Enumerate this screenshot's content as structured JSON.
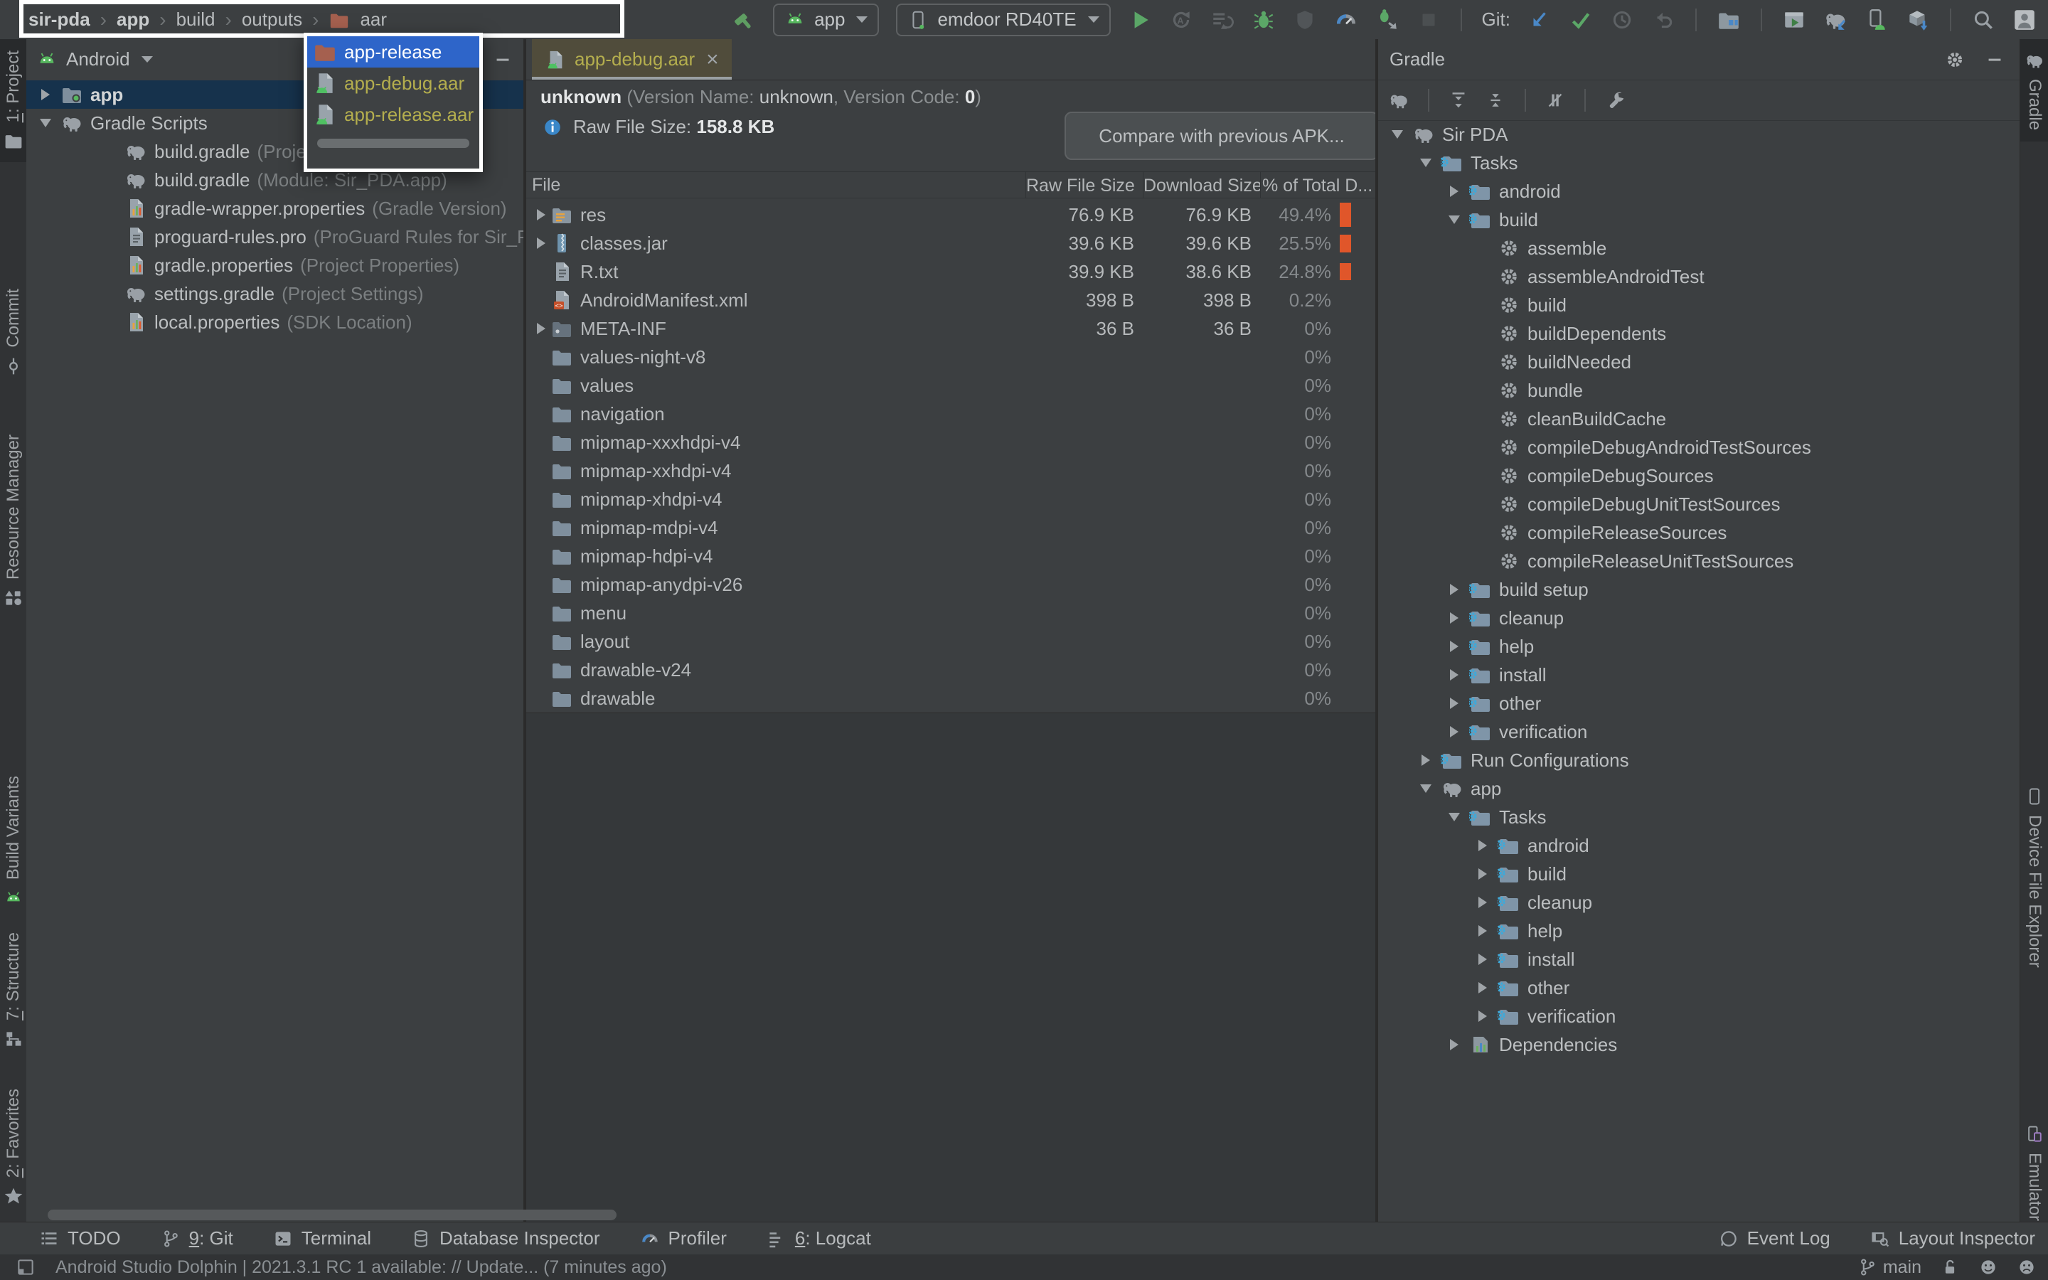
{
  "topbar": {
    "separator": "›",
    "breadcrumbs": [
      {
        "label": "sir-pda",
        "bold": true
      },
      {
        "label": "app",
        "bold": true
      },
      {
        "label": "build",
        "bold": false
      },
      {
        "label": "outputs",
        "bold": false
      },
      {
        "label": "aar",
        "bold": false,
        "icon": "folder-brown-icon"
      }
    ],
    "run_config": {
      "icon": "android-robot-icon",
      "label": "app"
    },
    "device": {
      "icon": "phone-green-dot-icon",
      "label": "emdoor RD40TE"
    },
    "git_label": "Git:",
    "groups": [
      {
        "type": "icons",
        "items": [
          {
            "icon": "hammer-icon",
            "enabled": true
          }
        ]
      },
      {
        "type": "combo",
        "ref": "run_config"
      },
      {
        "type": "combo",
        "ref": "device"
      },
      {
        "type": "icons",
        "items": [
          {
            "icon": "run-icon",
            "enabled": true
          },
          {
            "icon": "rerun-icon",
            "enabled": false
          },
          {
            "icon": "apply-changes-icon",
            "enabled": false
          },
          {
            "icon": "debug-icon",
            "enabled": true
          },
          {
            "icon": "profile-icon",
            "enabled": false
          },
          {
            "icon": "profiler-icon",
            "enabled": true
          },
          {
            "icon": "attach-debugger-icon",
            "enabled": true
          },
          {
            "icon": "stop-icon",
            "enabled": false
          }
        ]
      },
      {
        "type": "sep"
      },
      {
        "type": "label",
        "ref": "git_label"
      },
      {
        "type": "icons",
        "items": [
          {
            "icon": "git-update-icon",
            "enabled": true
          },
          {
            "icon": "git-commit-icon",
            "enabled": true
          },
          {
            "icon": "history-icon",
            "enabled": false
          },
          {
            "icon": "rollback-icon",
            "enabled": false
          }
        ]
      },
      {
        "type": "sep"
      },
      {
        "type": "icons",
        "items": [
          {
            "icon": "device-manager-icon",
            "enabled": true
          }
        ]
      },
      {
        "type": "sep"
      },
      {
        "type": "icons",
        "items": [
          {
            "icon": "run-anything-icon",
            "enabled": true
          },
          {
            "icon": "gradle-sync-icon",
            "enabled": true
          },
          {
            "icon": "pair-device-icon",
            "enabled": true
          },
          {
            "icon": "sdk-manager-icon",
            "enabled": true
          }
        ]
      },
      {
        "type": "sep"
      },
      {
        "type": "icons",
        "items": [
          {
            "icon": "search-icon",
            "enabled": true
          },
          {
            "icon": "avatar-icon",
            "enabled": true
          }
        ]
      }
    ]
  },
  "left_strip": [
    {
      "label": "1: Project",
      "icon": "project-folder-icon",
      "active": true
    },
    {
      "label": "Commit",
      "icon": "commit-icon",
      "active": false
    },
    {
      "label": "Resource Manager",
      "icon": "resource-manager-icon",
      "active": false
    },
    {
      "label": "Build Variants",
      "icon": "android-robot-icon",
      "active": false
    },
    {
      "label": "7: Structure",
      "icon": "structure-icon",
      "active": false
    },
    {
      "label": "2: Favorites",
      "icon": "star-icon",
      "active": false
    }
  ],
  "right_strip": [
    {
      "label": "Gradle",
      "icon": "elephant-icon",
      "active": true
    },
    {
      "label": "Device File Explorer",
      "icon": "device-phone-icon",
      "active": false
    },
    {
      "label": "Emulator",
      "icon": "emulator-phone-icon",
      "active": false
    }
  ],
  "project_panel": {
    "selector": {
      "icon": "android-robot-icon",
      "label": "Android"
    },
    "hide_icon": "hide-icon",
    "tree": [
      {
        "label": "app",
        "secondary": "",
        "icon": "module-folder-icon",
        "arrow": "closed",
        "indent": 0,
        "bold": true,
        "selected": true
      },
      {
        "label": "Gradle Scripts",
        "secondary": "",
        "icon": "elephant-icon",
        "arrow": "open",
        "indent": 0,
        "bold": false,
        "selected": false
      },
      {
        "label": "build.gradle",
        "secondary": "(Project: Sir_PDA)",
        "icon": "elephant-icon",
        "arrow": "none",
        "indent": 1,
        "bold": false,
        "selected": false
      },
      {
        "label": "build.gradle",
        "secondary": "(Module: Sir_PDA.app)",
        "icon": "elephant-icon",
        "arrow": "none",
        "indent": 1,
        "bold": false,
        "selected": false
      },
      {
        "label": "gradle-wrapper.properties",
        "secondary": "(Gradle Version)",
        "icon": "properties-file-icon",
        "arrow": "none",
        "indent": 1,
        "bold": false,
        "selected": false
      },
      {
        "label": "proguard-rules.pro",
        "secondary": "(ProGuard Rules for Sir_PDA)",
        "icon": "text-file-icon",
        "arrow": "none",
        "indent": 1,
        "bold": false,
        "selected": false
      },
      {
        "label": "gradle.properties",
        "secondary": "(Project Properties)",
        "icon": "properties-file-icon",
        "arrow": "none",
        "indent": 1,
        "bold": false,
        "selected": false
      },
      {
        "label": "settings.gradle",
        "secondary": "(Project Settings)",
        "icon": "elephant-icon",
        "arrow": "none",
        "indent": 1,
        "bold": false,
        "selected": false
      },
      {
        "label": "local.properties",
        "secondary": "(SDK Location)",
        "icon": "properties-file-icon",
        "arrow": "none",
        "indent": 1,
        "bold": false,
        "selected": false
      }
    ]
  },
  "popup": {
    "items": [
      {
        "label": "app-release",
        "icon": "folder-brown-icon",
        "selected": true
      },
      {
        "label": "app-debug.aar",
        "icon": "aar-file-icon",
        "selected": false
      },
      {
        "label": "app-release.aar",
        "icon": "aar-file-icon",
        "selected": false
      }
    ]
  },
  "analyzer": {
    "tab": {
      "icon": "aar-file-icon",
      "label": "app-debug.aar",
      "close": "×"
    },
    "version": {
      "name": "unknown",
      "part1": " (Version Name: ",
      "vname": "unknown",
      "part2": ", Version Code: ",
      "vcode": "0",
      "part3": ")"
    },
    "raw_icon": "info-icon",
    "raw_label": "Raw File Size: ",
    "raw_value": "158.8 KB",
    "compare_button": "Compare with previous APK...",
    "table": {
      "columns": [
        "File",
        "Raw File Size",
        "Download Size",
        "% of Total D..."
      ],
      "rows": [
        {
          "name": "res",
          "icon": "res-folder-icon",
          "expandable": true,
          "raw": "76.9 KB",
          "download": "76.9 KB",
          "pct": "49.4%",
          "bar": 0.85
        },
        {
          "name": "classes.jar",
          "icon": "jar-icon",
          "expandable": true,
          "raw": "39.6 KB",
          "download": "39.6 KB",
          "pct": "25.5%",
          "bar": 0.62
        },
        {
          "name": "R.txt",
          "icon": "text-file-icon",
          "expandable": false,
          "raw": "39.9 KB",
          "download": "38.6 KB",
          "pct": "24.8%",
          "bar": 0.6
        },
        {
          "name": "AndroidManifest.xml",
          "icon": "xml-file-icon",
          "expandable": false,
          "raw": "398 B",
          "download": "398 B",
          "pct": "0.2%",
          "bar": 0
        },
        {
          "name": "META-INF",
          "icon": "meta-folder-icon",
          "expandable": true,
          "raw": "36 B",
          "download": "36 B",
          "pct": "0%",
          "bar": 0
        },
        {
          "name": "values-night-v8",
          "icon": "folder-icon",
          "expandable": false,
          "raw": "",
          "download": "",
          "pct": "0%",
          "bar": 0
        },
        {
          "name": "values",
          "icon": "folder-icon",
          "expandable": false,
          "raw": "",
          "download": "",
          "pct": "0%",
          "bar": 0
        },
        {
          "name": "navigation",
          "icon": "folder-icon",
          "expandable": false,
          "raw": "",
          "download": "",
          "pct": "0%",
          "bar": 0
        },
        {
          "name": "mipmap-xxxhdpi-v4",
          "icon": "folder-icon",
          "expandable": false,
          "raw": "",
          "download": "",
          "pct": "0%",
          "bar": 0
        },
        {
          "name": "mipmap-xxhdpi-v4",
          "icon": "folder-icon",
          "expandable": false,
          "raw": "",
          "download": "",
          "pct": "0%",
          "bar": 0
        },
        {
          "name": "mipmap-xhdpi-v4",
          "icon": "folder-icon",
          "expandable": false,
          "raw": "",
          "download": "",
          "pct": "0%",
          "bar": 0
        },
        {
          "name": "mipmap-mdpi-v4",
          "icon": "folder-icon",
          "expandable": false,
          "raw": "",
          "download": "",
          "pct": "0%",
          "bar": 0
        },
        {
          "name": "mipmap-hdpi-v4",
          "icon": "folder-icon",
          "expandable": false,
          "raw": "",
          "download": "",
          "pct": "0%",
          "bar": 0
        },
        {
          "name": "mipmap-anydpi-v26",
          "icon": "folder-icon",
          "expandable": false,
          "raw": "",
          "download": "",
          "pct": "0%",
          "bar": 0
        },
        {
          "name": "menu",
          "icon": "folder-icon",
          "expandable": false,
          "raw": "",
          "download": "",
          "pct": "0%",
          "bar": 0
        },
        {
          "name": "layout",
          "icon": "folder-icon",
          "expandable": false,
          "raw": "",
          "download": "",
          "pct": "0%",
          "bar": 0
        },
        {
          "name": "drawable-v24",
          "icon": "folder-icon",
          "expandable": false,
          "raw": "",
          "download": "",
          "pct": "0%",
          "bar": 0
        },
        {
          "name": "drawable",
          "icon": "folder-icon",
          "expandable": false,
          "raw": "",
          "download": "",
          "pct": "0%",
          "bar": 0
        }
      ]
    }
  },
  "gradle_panel": {
    "title": "Gradle",
    "header_icons": [
      {
        "icon": "settings-gear-icon"
      },
      {
        "icon": "hide-icon"
      }
    ],
    "toolbar": [
      {
        "type": "icon",
        "icon": "elephant-icon"
      },
      {
        "type": "sep"
      },
      {
        "type": "icon",
        "icon": "expand-all-icon"
      },
      {
        "type": "icon",
        "icon": "collapse-all-icon"
      },
      {
        "type": "sep"
      },
      {
        "type": "icon",
        "icon": "offline-mode-icon"
      },
      {
        "type": "sep"
      },
      {
        "type": "icon",
        "icon": "wrench-icon"
      }
    ],
    "tree": [
      {
        "label": "Sir PDA",
        "icon": "elephant-icon",
        "arrow": "open",
        "indent": 0
      },
      {
        "label": "Tasks",
        "icon": "taskfolder-icon",
        "arrow": "open",
        "indent": 1
      },
      {
        "label": "android",
        "icon": "taskfolder-icon",
        "arrow": "closed",
        "indent": 2
      },
      {
        "label": "build",
        "icon": "taskfolder-icon",
        "arrow": "open",
        "indent": 2
      },
      {
        "label": "assemble",
        "icon": "gear-icon",
        "arrow": "none",
        "indent": 3
      },
      {
        "label": "assembleAndroidTest",
        "icon": "gear-icon",
        "arrow": "none",
        "indent": 3
      },
      {
        "label": "build",
        "icon": "gear-icon",
        "arrow": "none",
        "indent": 3
      },
      {
        "label": "buildDependents",
        "icon": "gear-icon",
        "arrow": "none",
        "indent": 3
      },
      {
        "label": "buildNeeded",
        "icon": "gear-icon",
        "arrow": "none",
        "indent": 3
      },
      {
        "label": "bundle",
        "icon": "gear-icon",
        "arrow": "none",
        "indent": 3
      },
      {
        "label": "cleanBuildCache",
        "icon": "gear-icon",
        "arrow": "none",
        "indent": 3
      },
      {
        "label": "compileDebugAndroidTestSources",
        "icon": "gear-icon",
        "arrow": "none",
        "indent": 3
      },
      {
        "label": "compileDebugSources",
        "icon": "gear-icon",
        "arrow": "none",
        "indent": 3
      },
      {
        "label": "compileDebugUnitTestSources",
        "icon": "gear-icon",
        "arrow": "none",
        "indent": 3
      },
      {
        "label": "compileReleaseSources",
        "icon": "gear-icon",
        "arrow": "none",
        "indent": 3
      },
      {
        "label": "compileReleaseUnitTestSources",
        "icon": "gear-icon",
        "arrow": "none",
        "indent": 3
      },
      {
        "label": "build setup",
        "icon": "taskfolder-icon",
        "arrow": "closed",
        "indent": 2
      },
      {
        "label": "cleanup",
        "icon": "taskfolder-icon",
        "arrow": "closed",
        "indent": 2
      },
      {
        "label": "help",
        "icon": "taskfolder-icon",
        "arrow": "closed",
        "indent": 2
      },
      {
        "label": "install",
        "icon": "taskfolder-icon",
        "arrow": "closed",
        "indent": 2
      },
      {
        "label": "other",
        "icon": "taskfolder-icon",
        "arrow": "closed",
        "indent": 2
      },
      {
        "label": "verification",
        "icon": "taskfolder-icon",
        "arrow": "closed",
        "indent": 2
      },
      {
        "label": "Run Configurations",
        "icon": "taskfolder-icon",
        "arrow": "closed",
        "indent": 1
      },
      {
        "label": "app",
        "icon": "elephant-icon",
        "arrow": "open",
        "indent": 1
      },
      {
        "label": "Tasks",
        "icon": "taskfolder-icon",
        "arrow": "open",
        "indent": 2
      },
      {
        "label": "android",
        "icon": "taskfolder-icon",
        "arrow": "closed",
        "indent": 3
      },
      {
        "label": "build",
        "icon": "taskfolder-icon",
        "arrow": "closed",
        "indent": 3
      },
      {
        "label": "cleanup",
        "icon": "taskfolder-icon",
        "arrow": "closed",
        "indent": 3
      },
      {
        "label": "help",
        "icon": "taskfolder-icon",
        "arrow": "closed",
        "indent": 3
      },
      {
        "label": "install",
        "icon": "taskfolder-icon",
        "arrow": "closed",
        "indent": 3
      },
      {
        "label": "other",
        "icon": "taskfolder-icon",
        "arrow": "closed",
        "indent": 3
      },
      {
        "label": "verification",
        "icon": "taskfolder-icon",
        "arrow": "closed",
        "indent": 3
      },
      {
        "label": "Dependencies",
        "icon": "deps-icon",
        "arrow": "closed",
        "indent": 2
      }
    ]
  },
  "bottom_bar": {
    "left": [
      {
        "label": "TODO",
        "icon": "todo-icon"
      },
      {
        "label": "9: Git",
        "icon": "git-branch-icon"
      },
      {
        "label": "Terminal",
        "icon": "terminal-icon"
      },
      {
        "label": "Database Inspector",
        "icon": "database-icon"
      },
      {
        "label": "Profiler",
        "icon": "profiler-icon"
      },
      {
        "label": "6: Logcat",
        "icon": "logcat-icon"
      }
    ],
    "right": [
      {
        "label": "Event Log",
        "icon": "event-log-icon"
      },
      {
        "label": "Layout Inspector",
        "icon": "layout-inspector-icon"
      }
    ]
  },
  "status_bar": {
    "toggle_icon": "toolwindows-icon",
    "message": "Android Studio Dolphin | 2021.3.1 RC 1 available: // Update... (7 minutes ago)",
    "branch": {
      "icon": "git-branch-icon",
      "label": "main"
    },
    "icons": [
      "unlock-icon",
      "happy-face-icon",
      "sad-face-icon"
    ]
  }
}
